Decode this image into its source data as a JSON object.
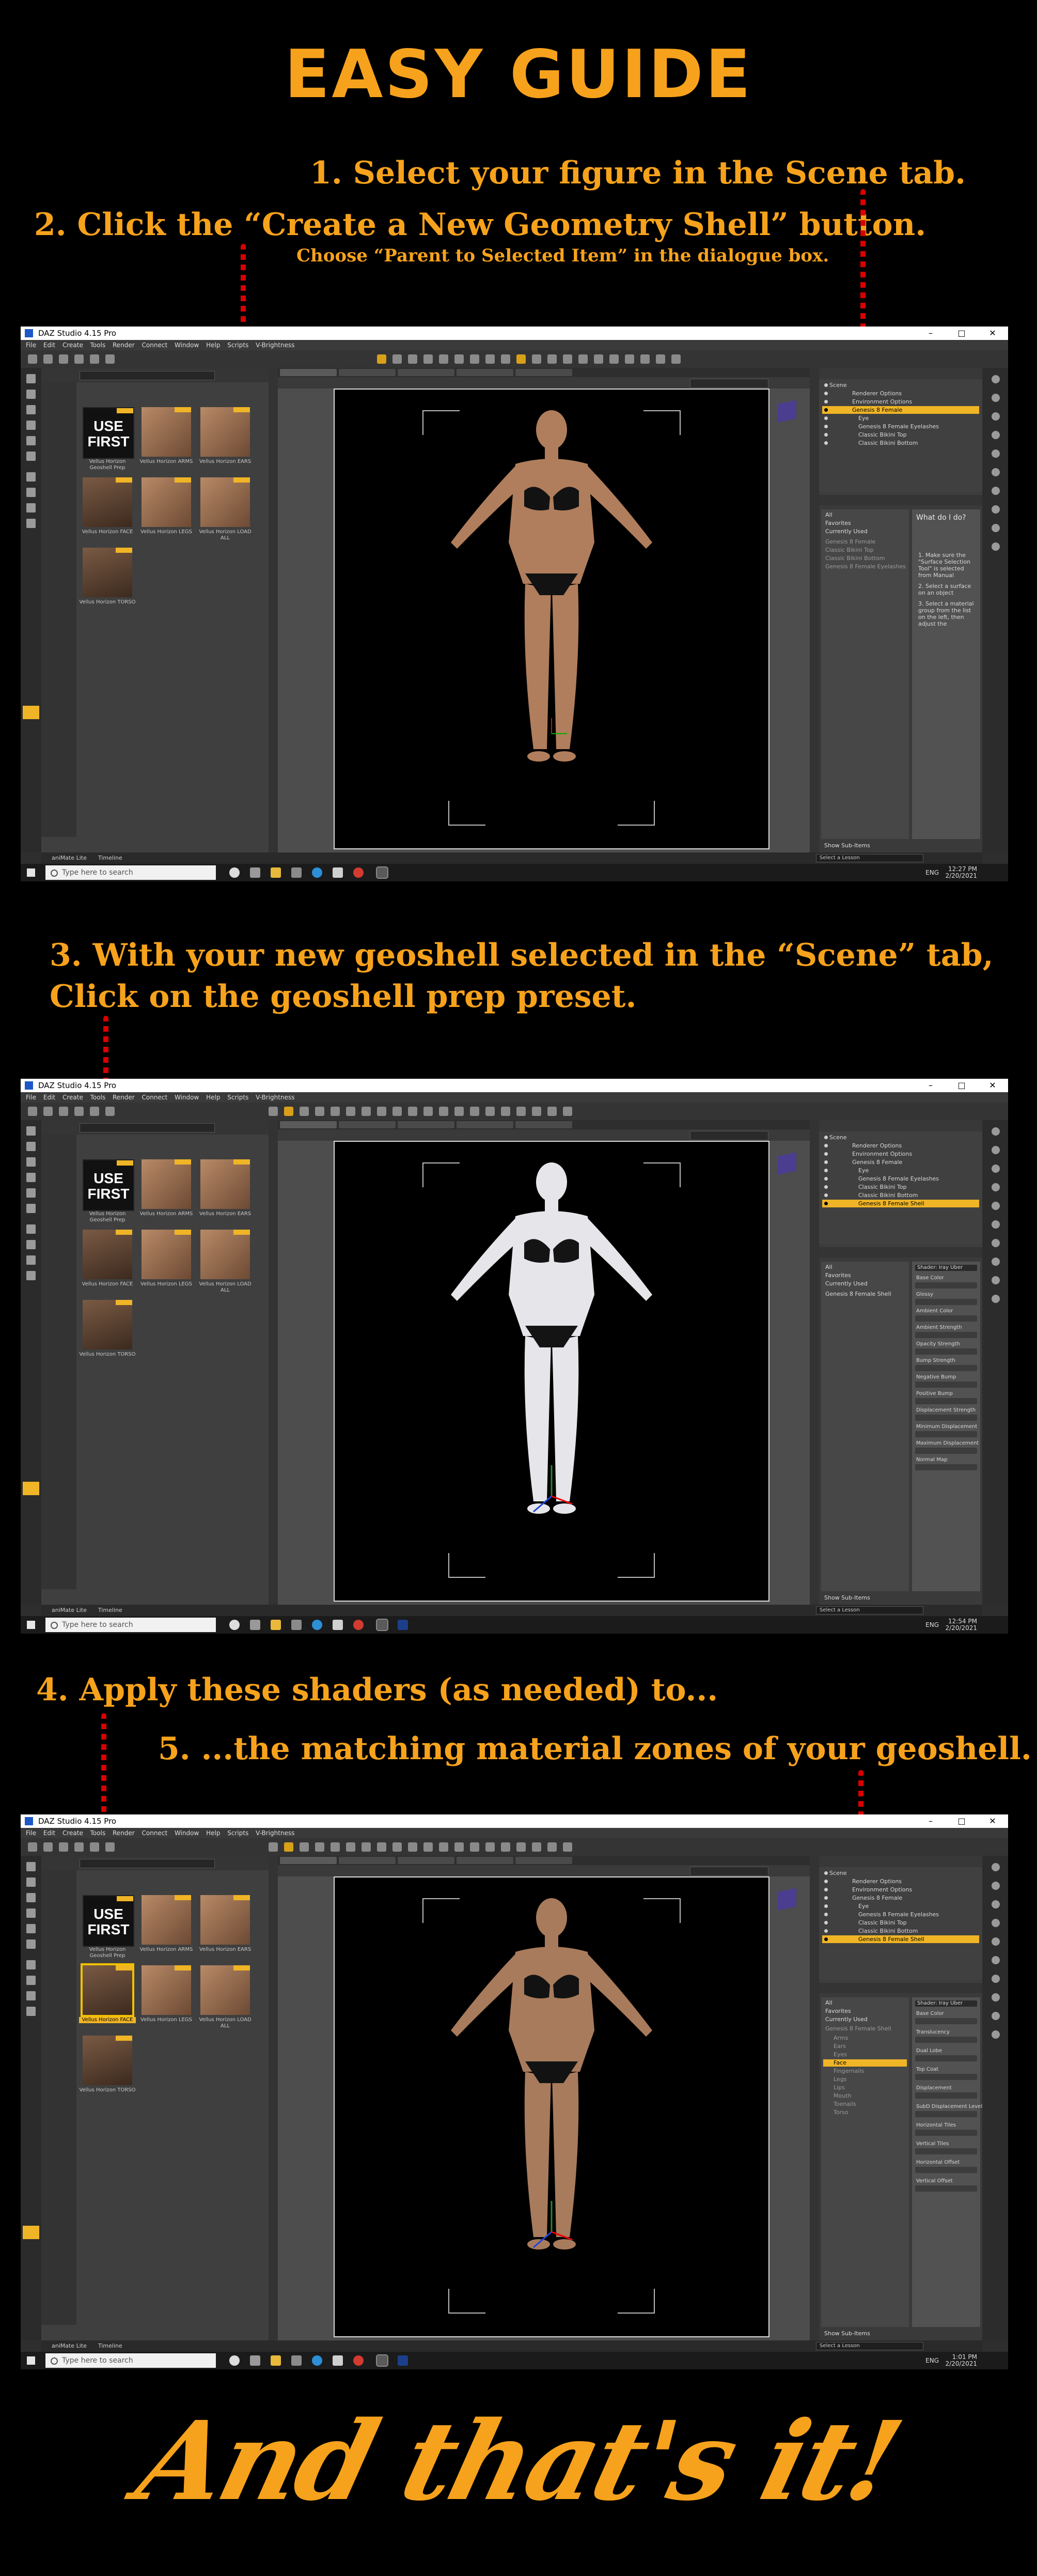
{
  "title": "EASY GUIDE",
  "outro": "And that's it!",
  "accent_color": "#f7a21c",
  "steps": {
    "s1": "1. Select your figure in the Scene tab.",
    "s2": "2. Click the “Create a New Geometry Shell” button.",
    "s2_sub": "Choose “Parent to Selected Item” in the dialogue box.",
    "s3_line1": "3. With your new geoshell selected in the “Scene” tab,",
    "s3_line2": "Click on the geoshell prep preset.",
    "s4": "4. Apply these shaders (as needed) to...",
    "s5": "5. ...the matching material zones of your geoshell."
  },
  "app": {
    "window_title": "DAZ Studio 4.15 Pro",
    "window_controls": [
      "–",
      "□",
      "✕"
    ],
    "menu": "File Edit Create Tools Render Connect Window Help Scripts V-Brightness",
    "thumbnails": [
      {
        "caption": "Vellus Horizon Geoshell Prep",
        "use_first": "USE FIRST"
      },
      {
        "caption": "Vellus Horizon ARMS"
      },
      {
        "caption": "Vellus Horizon EARS"
      },
      {
        "caption": "Vellus Horizon FACE"
      },
      {
        "caption": "Vellus Horizon LEGS"
      },
      {
        "caption": "Vellus Horizon LOAD ALL"
      },
      {
        "caption": "Vellus Horizon TORSO"
      }
    ],
    "scene_items_1": [
      "Scene",
      "Renderer Options",
      "Environment Options",
      "Genesis 8 Female",
      "Eye",
      "Genesis 8 Female Eyelashes",
      "Classic Bikini Top",
      "Classic Bikini Bottom"
    ],
    "scene_items_23": [
      "Scene",
      "Renderer Options",
      "Environment Options",
      "Genesis 8 Female",
      "Eye",
      "Genesis 8 Female Eyelashes",
      "Classic Bikini Top",
      "Classic Bikini Bottom",
      "Genesis 8 Female Shell"
    ],
    "surface_list_1": [
      "All",
      "Favorites",
      "Currently Used",
      "Genesis 8 Female",
      "Classic Bikini Top",
      "Classic Bikini Bottom",
      "Genesis 8 Female Eyelashes"
    ],
    "surface_list_2": [
      "All",
      "Favorites",
      "Currently Used",
      "Genesis 8 Female Shell"
    ],
    "surface_list_3": [
      "All",
      "Favorites",
      "Currently Used",
      "Genesis 8 Female Shell",
      "Arms",
      "Ears",
      "Eyes",
      "Face",
      "Fingernails",
      "Legs",
      "Lips",
      "Mouth",
      "Toenails",
      "Torso"
    ],
    "help_title": "What do I do?",
    "help_steps": [
      "1. Make sure the \"Surface Selection Tool\" is selected from Manual",
      "2. Select a surface on an object",
      "3. Select a material group from the list on the left, then adjust the"
    ],
    "surface_props_2": [
      "Base Color",
      "Glossy",
      "Ambient Color",
      "Ambient Strength",
      "Opacity Strength",
      "Bump Strength",
      "Negative Bump",
      "Positive Bump",
      "Displacement Strength",
      "Minimum Displacement",
      "Maximum Displacement",
      "Normal Map"
    ],
    "surface_props_3": [
      "Base Color",
      "Translucency",
      "Dual Lobe",
      "Top Coat",
      "Displacement",
      "SubD Displacement Level",
      "Horizontal Tiles",
      "Vertical Tiles",
      "Horizontal Offset",
      "Vertical Offset"
    ],
    "shader_label": "Shader: Iray Uber",
    "show_sub_items": "Show Sub-Items",
    "bottom_tabs": [
      "aniMate Lite",
      "Timeline"
    ],
    "lesson": "Select a Lesson",
    "search_placeholder": "Type here to search",
    "lang": "ENG",
    "clock": [
      {
        "time": "12:27 PM",
        "date": "2/20/2021"
      },
      {
        "time": "12:54 PM",
        "date": "2/20/2021"
      },
      {
        "time": "1:01 PM",
        "date": "2/20/2021"
      }
    ]
  }
}
